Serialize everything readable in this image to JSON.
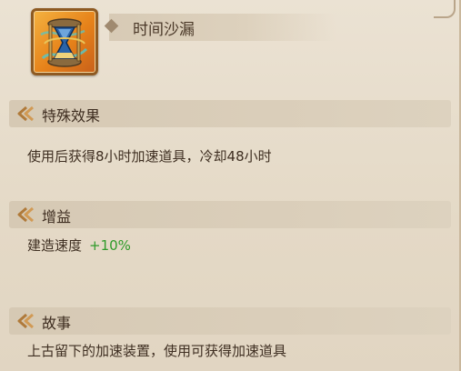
{
  "item": {
    "icon": "hourglass-icon",
    "name": "时间沙漏"
  },
  "sections": {
    "effect": {
      "title": "特殊效果",
      "text": "使用后获得8小时加速道具，冷却48小时"
    },
    "buff": {
      "title": "增益",
      "stat_label": "建造速度",
      "stat_value": "+10%"
    },
    "story": {
      "title": "故事",
      "text": "上古留下的加速装置，使用可获得加速道具"
    }
  },
  "colors": {
    "bonus_green": "#2f9a2a",
    "frame_orange": "#e6821a",
    "accent_gold": "#c9a253"
  }
}
